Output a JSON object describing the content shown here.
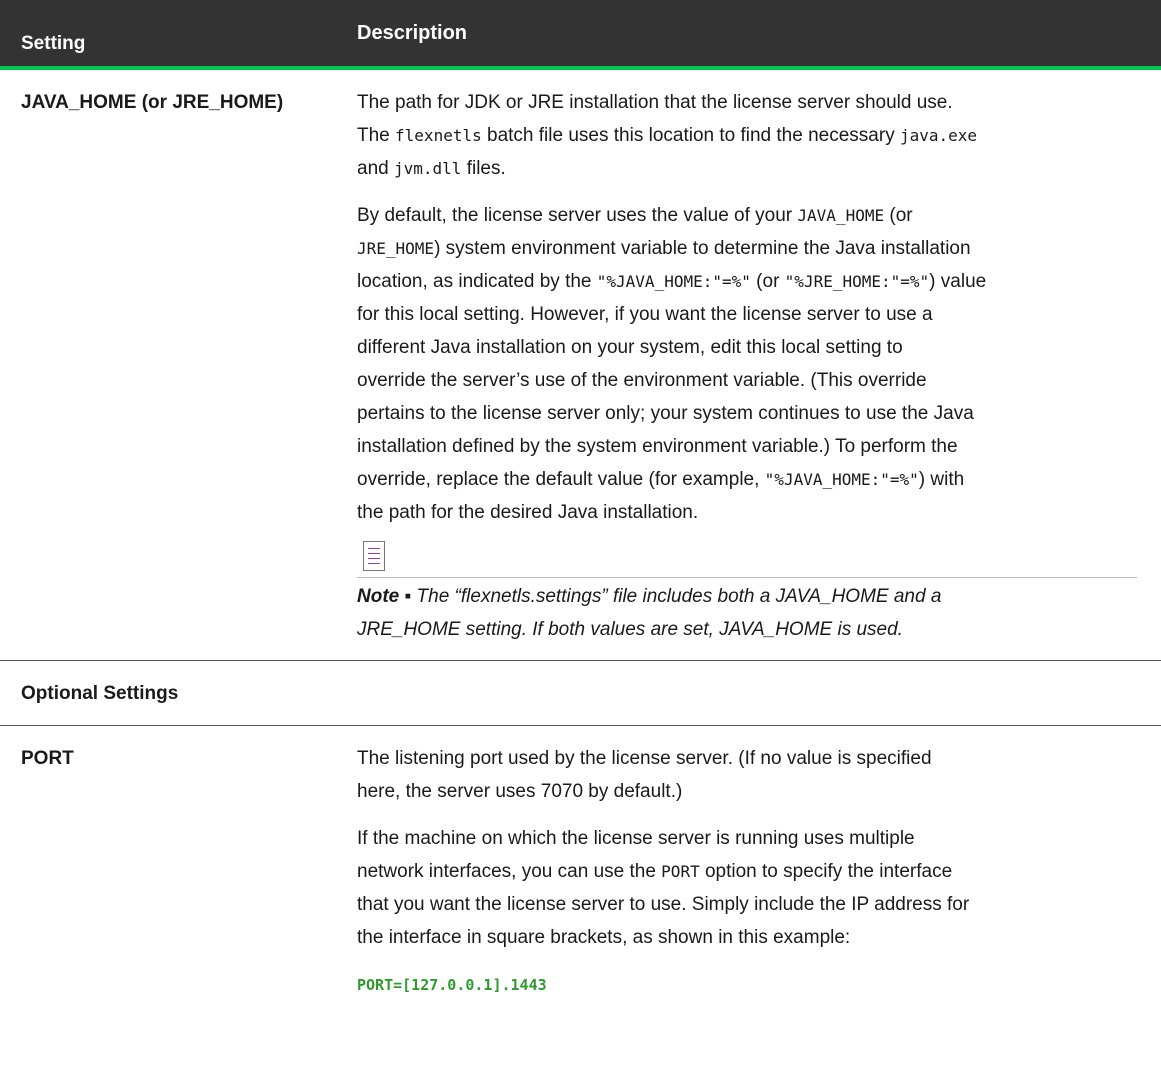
{
  "header": {
    "col1": "Setting",
    "col2": "Description"
  },
  "java_row": {
    "name": "JAVA_HOME (or JRE_HOME)",
    "p1": [
      "The path for JDK or JRE installation that the license server should use.",
      "The ",
      "flexnetls",
      " batch file uses this location to find the necessary ",
      "java.exe",
      "and ",
      "jvm.dll",
      " files."
    ],
    "p2": {
      "a": "By default, the license server uses the value of your ",
      "code1": "JAVA_HOME",
      "b": " (or",
      "code2": "JRE_HOME",
      "c": ") system environment variable to determine the Java installation",
      "d": "location, as indicated by the ",
      "code3": "\"%JAVA_HOME:\"=%\"",
      "e": " (or ",
      "code4": "\"%JRE_HOME:\"=%\"",
      "f": ") value",
      "g": "for this local setting. However, if you want the license server to use a",
      "h": "different Java installation on your system, edit this local setting to",
      "i": "override the server’s use of the environment variable. (This override",
      "j": "pertains to the license server only; your system continues to use the Java",
      "k": "installation defined by the system environment variable.) To perform the",
      "l": "override, replace the default value (for example, ",
      "code5": "\"%JAVA_HOME:\"=%\"",
      "m": ") with",
      "n": "the path for the desired Java installation."
    },
    "note_label": "Note ▪",
    "note_line1": "The “flexnetls.settings” file includes both a JAVA_HOME and a",
    "note_line2": "JRE_HOME setting. If both values are set, JAVA_HOME is used."
  },
  "optional_row": {
    "name": "Optional Settings"
  },
  "port_row": {
    "name": "PORT",
    "p1_line1": "The listening port used by the license server. (If no value is specified",
    "p1_line2": "here, the server uses 7070 by default.)",
    "p2_line1": "If the machine on which the license server is running uses multiple",
    "p2_a": "network interfaces, you can use the ",
    "p2_code": "PORT",
    "p2_b": " option to specify the interface",
    "p2_line3": "that you want the license server to use. Simply include the IP address for",
    "p2_line4": "the interface in square brackets, as shown in this example:",
    "example": "PORT=[127.0.0.1].1443"
  },
  "icons": {
    "note": "note-icon"
  },
  "colors": {
    "header_bg": "#333333",
    "accent": "#00c853",
    "code_green": "#2e9b2e",
    "note_icon": "#8e44ad"
  }
}
